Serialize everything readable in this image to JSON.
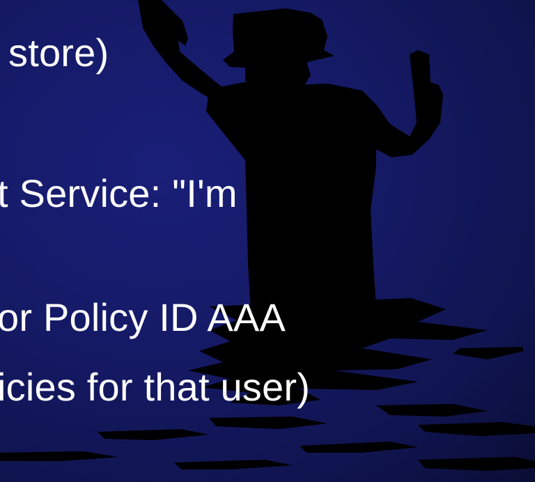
{
  "slide": {
    "lines": [
      " store)",
      "t Service: \"I'm",
      "or Policy ID AAA",
      "icies for that user)"
    ]
  },
  "colors": {
    "background": "#151a66",
    "text": "#ffffff",
    "silhouette": "#000000"
  },
  "image": {
    "subject": "silhouette-of-person-in-water-with-raised-arms"
  }
}
